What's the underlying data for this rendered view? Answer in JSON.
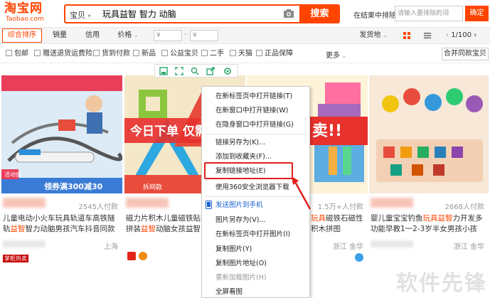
{
  "header": {
    "logo_cn": "淘宝网",
    "logo_en": "Taobao.com",
    "search_category": "宝贝",
    "search_query": "玩具益智 智力 动脑",
    "search_button": "搜索",
    "within_results_label": "在结果中排除",
    "within_results_placeholder": "请输入要排除的词",
    "confirm_button": "确定"
  },
  "sortbar": {
    "items": [
      "综合排序",
      "销量",
      "信用",
      "价格"
    ],
    "price_from": "¥",
    "price_to": "¥",
    "ship_from": "发货地",
    "pager": "1/100"
  },
  "filters": {
    "items": [
      "包邮",
      "赠送退货运费险",
      "货到付款",
      "新品",
      "公益宝贝",
      "二手",
      "天猫",
      "正品保障"
    ],
    "more": "更多",
    "merge": "合并同款宝贝"
  },
  "products": [
    {
      "sales": "2545人付款",
      "title_pre": "儿童电动小火车玩具轨道车高铁隧轨",
      "title_hl": "益智",
      "title_post": "智力动脑男孩汽车抖音同款",
      "location": "上海",
      "badge": "掌柜热卖",
      "promo": "领券满300减30",
      "activity": "活动价"
    },
    {
      "sales": "",
      "title_pre": "磁力片积木儿童磁铁贴拼装",
      "title_hl": "益智",
      "title_post": "动脑女孩益智拼装",
      "location": "",
      "badge": "",
      "promo": "今日下单 仅需",
      "activity": "拆网款"
    },
    {
      "sales": "1.5万+人付款",
      "title_pre": "",
      "title_hl": "玩具",
      "title_post": "磁铁石磁性积木拼图",
      "location": "浙江 金华",
      "badge": "",
      "promo": "卖!!",
      "activity": ""
    },
    {
      "sales": "2668人付款",
      "title_pre": "婴儿童宝宝钓鱼",
      "title_hl": "玩具益智",
      "title_post": "力开发多功能早教1一2-3岁半女男孩小孩",
      "location": "浙江 金华",
      "badge": "",
      "promo": "",
      "activity": ""
    }
  ],
  "context_menu": {
    "items": [
      "在新标签页中打开链接(T)",
      "在新窗口中打开链接(W)",
      "在隐身窗口中打开链接(G)",
      "链接另存为(K)...",
      "添加到收藏夹(F)...",
      "复制链接地址(E)",
      "使用360安全浏览器下载",
      "发送图片到手机",
      "图片另存为(V)...",
      "在新标签页中打开图片(I)",
      "复制图片(Y)",
      "复制图片地址(O)",
      "重新加载图片(H)",
      "全屏看图"
    ]
  },
  "colors": {
    "brand": "#ff4400",
    "highlight_box": "#e0201c",
    "link_blue": "#1a62d0"
  },
  "watermark": "软件先锋"
}
